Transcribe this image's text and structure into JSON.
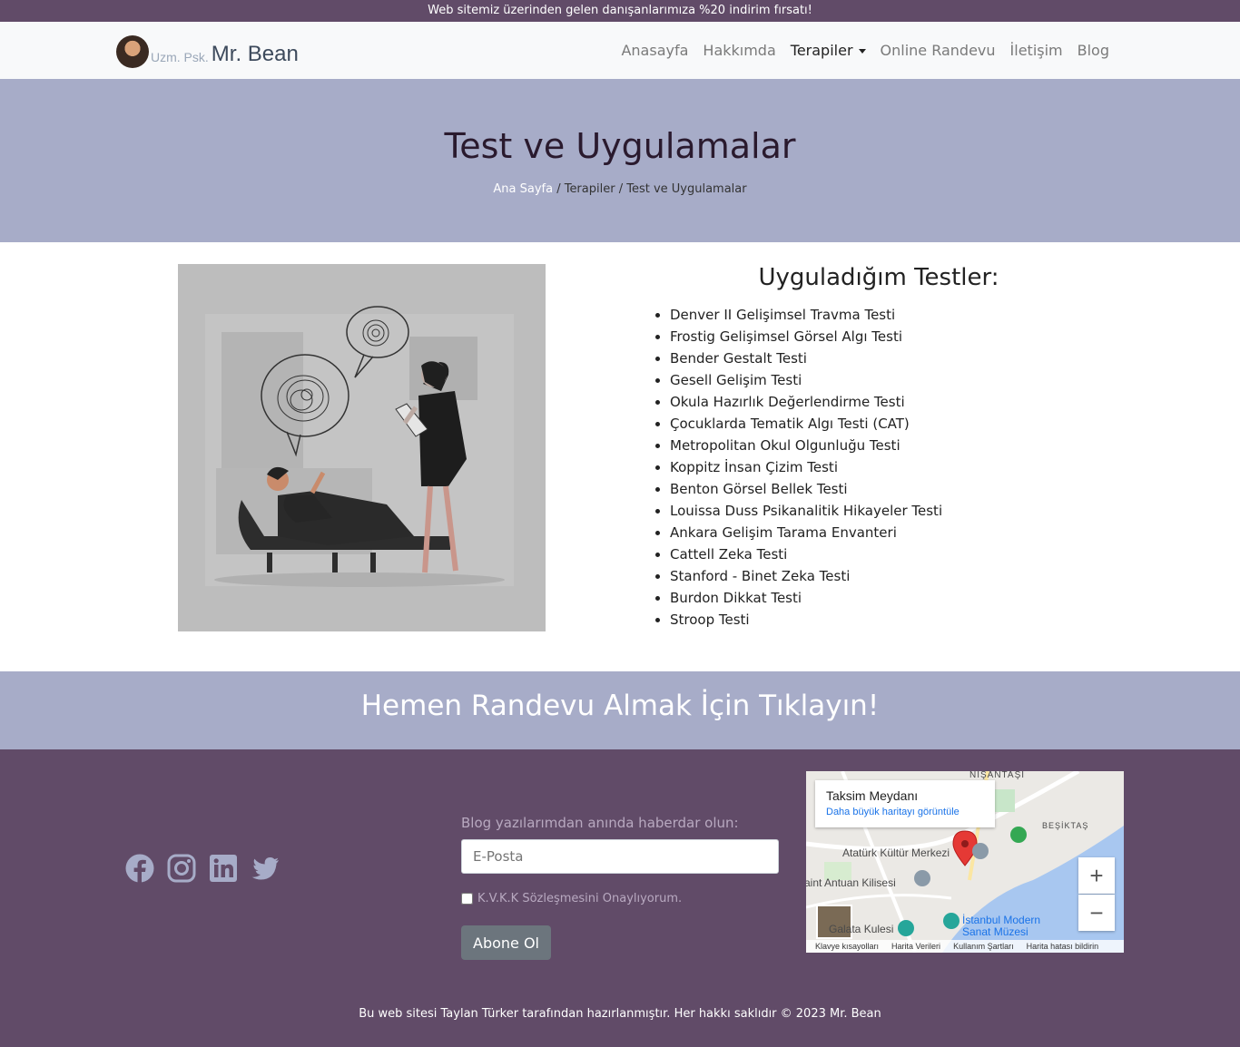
{
  "announcement": "Web sitemiz üzerinden gelen danışanlarımıza %20 indirim fırsatı!",
  "brand": {
    "prefix": "Uzm. Psk.",
    "name": "Mr. Bean"
  },
  "nav": {
    "items": [
      {
        "label": "Anasayfa"
      },
      {
        "label": "Hakkımda"
      },
      {
        "label": "Terapiler"
      },
      {
        "label": "Online Randevu"
      },
      {
        "label": "İletişim"
      },
      {
        "label": "Blog"
      }
    ]
  },
  "hero": {
    "title": "Test ve Uygulamalar",
    "breadcrumb": {
      "home": "Ana Sayfa",
      "rest": " / Terapiler / Test ve Uygulamalar"
    }
  },
  "tests": {
    "heading": "Uyguladığım Testler:",
    "items": [
      "Denver II Gelişimsel Travma Testi",
      "Frostig Gelişimsel Görsel Algı Testi",
      "Bender Gestalt Testi",
      "Gesell Gelişim Testi",
      "Okula Hazırlık Değerlendirme Testi",
      "Çocuklarda Tematik Algı Testi (CAT)",
      "Metropolitan Okul Olgunluğu Testi",
      "Koppitz İnsan Çizim Testi",
      "Benton Görsel Bellek Testi",
      "Louissa Duss Psikanalitik Hikayeler Testi",
      "Ankara Gelişim Tarama Envanteri",
      "Cattell Zeka Testi",
      "Stanford - Binet Zeka Testi",
      "Burdon Dikkat Testi",
      "Stroop Testi"
    ]
  },
  "cta": {
    "label": "Hemen Randevu Almak İçin Tıklayın!"
  },
  "newsletter": {
    "label": "Blog yazılarımdan anında haberdar olun:",
    "email_placeholder": "E-Posta",
    "kvkk_label": "K.V.K.K Sözleşmesini Onaylıyorum.",
    "subscribe_label": "Abone Ol"
  },
  "map": {
    "place": "Taksim Meydanı",
    "larger_map": "Daha büyük haritayı görüntüle",
    "labels": {
      "nisantasi": "NIŞANTAŞI",
      "besiktas": "BEŞİKTAŞ",
      "akm": "Atatürk Kültür Merkezi",
      "antuan": "Saint Antuan Kilisesi",
      "kulesi": "Galata Kulesi",
      "modern": "İstanbul Modern Sanat Müzesi"
    },
    "footer": [
      "Klavye kısayolları",
      "Harita Verileri",
      "Kullanım Şartları",
      "Harita hatası bildirin"
    ]
  },
  "copyright": "Bu web sitesi Taylan Türker tarafından hazırlanmıştır. Her hakkı saklıdır © 2023 Mr. Bean",
  "colors": {
    "plum": "#614b68",
    "lavender": "#a7acc8",
    "navbar": "#f8f9fa"
  },
  "icons": [
    "facebook-icon",
    "instagram-icon",
    "linkedin-icon",
    "twitter-icon",
    "map-pin-icon"
  ]
}
